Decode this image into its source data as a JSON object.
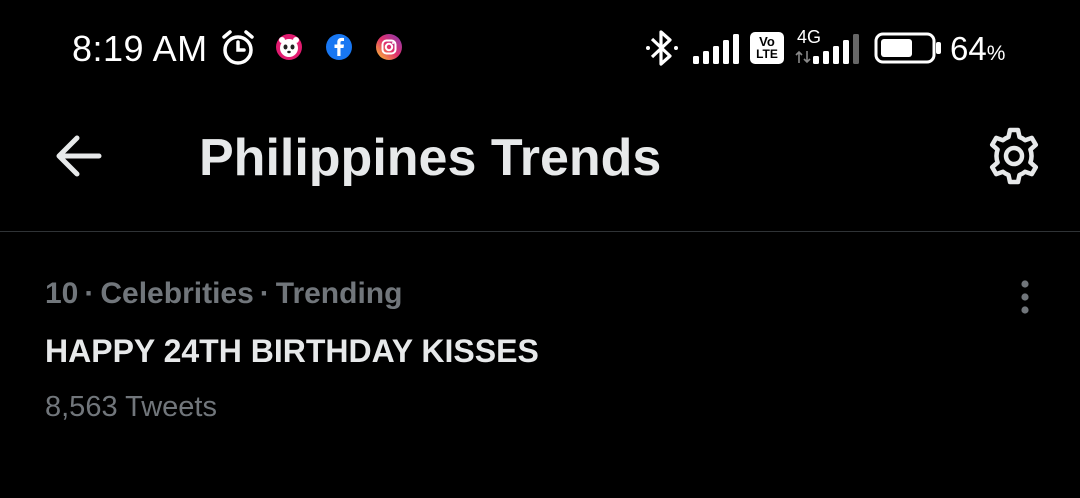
{
  "status_bar": {
    "time": "8:19 AM",
    "network_label": "4G",
    "volte_label_top": "Vo",
    "volte_label_bottom": "LTE",
    "battery_percent": "64",
    "battery_percent_sign": "%",
    "battery_level": 0.64,
    "notification_icons": [
      "alarm-icon",
      "foodpanda-icon",
      "facebook-icon",
      "instagram-icon"
    ],
    "system_icons": [
      "bluetooth-icon",
      "signal-icon",
      "volte-icon",
      "4g-signal-icon",
      "battery-icon"
    ]
  },
  "header": {
    "back_icon": "arrow-left-icon",
    "title": "Philippines Trends",
    "settings_icon": "gear-icon"
  },
  "trends": [
    {
      "rank": "10",
      "category": "Celebrities",
      "status": "Trending",
      "separator": "·",
      "name": "HAPPY 24TH BIRTHDAY KISSES",
      "tweet_count": "8,563 Tweets",
      "more_icon": "more-vertical-icon"
    }
  ],
  "colors": {
    "background": "#000000",
    "primary_text": "#e7e9ea",
    "secondary_text": "#71767b",
    "divider": "#2f3336",
    "foodpanda": "#e21b70",
    "facebook": "#1877f2",
    "instagram": "#e1306c"
  }
}
